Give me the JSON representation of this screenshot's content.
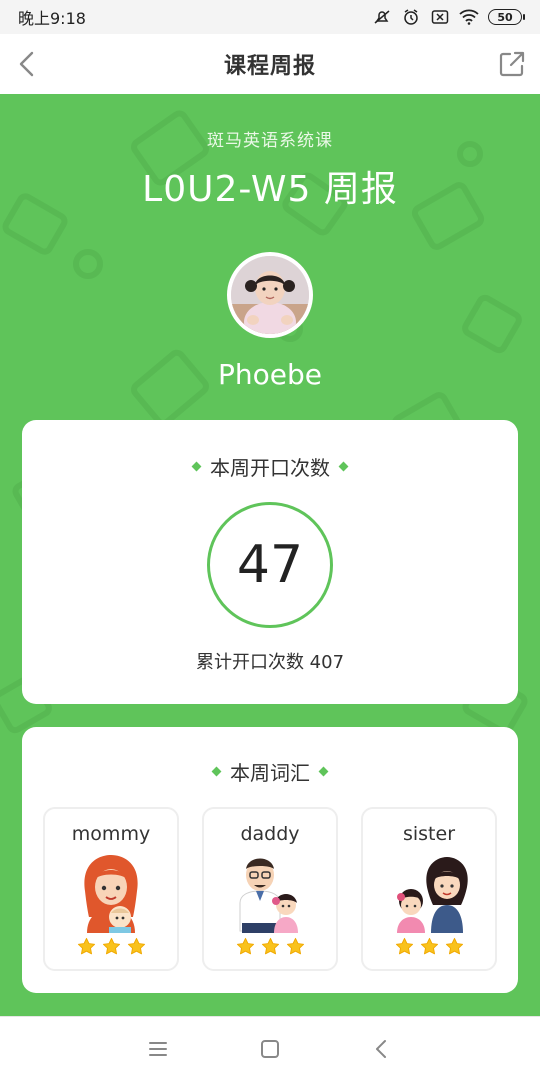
{
  "status_bar": {
    "time": "晚上9:18",
    "battery": "50",
    "icons": [
      "mute-icon",
      "alarm-icon",
      "sim-off-icon",
      "wifi-icon",
      "battery-icon"
    ]
  },
  "nav": {
    "title": "课程周报",
    "back_icon": "chevron-left-icon",
    "share_icon": "share-icon"
  },
  "report": {
    "course": "斑马英语系统课",
    "title": "L0U2-W5 周报",
    "student_name": "Phoebe"
  },
  "speaking": {
    "title": "本周开口次数",
    "count": "47",
    "total_text": "累计开口次数 407"
  },
  "vocab": {
    "title": "本周词汇",
    "words": [
      {
        "word": "mommy",
        "stars": 3
      },
      {
        "word": "daddy",
        "stars": 3
      },
      {
        "word": "sister",
        "stars": 3
      }
    ]
  },
  "colors": {
    "primary_green": "#5fc45a",
    "star": "#f9c21c"
  },
  "system_nav": [
    "menu-icon",
    "home-icon",
    "back-icon"
  ]
}
